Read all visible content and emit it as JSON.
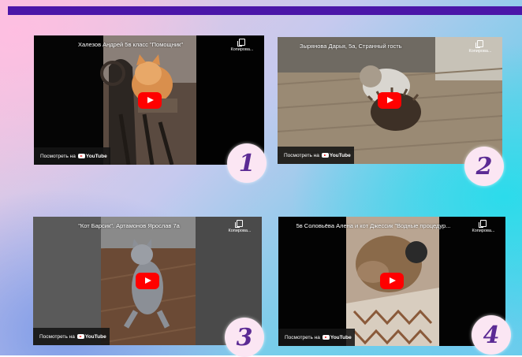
{
  "colors": {
    "top_bar": "#4b16a8",
    "badge_bg": "#fbe6f3",
    "badge_text": "#5b2a94",
    "play_red": "#ff0000"
  },
  "videos": [
    {
      "title": "Халезов Андрей 5в класс \"Помощник\"",
      "copy_label": "Копирова...",
      "watch_on": "Посмотреть на",
      "platform": "YouTube",
      "icons": [
        "copy-icon",
        "play-icon",
        "youtube-logo-icon"
      ],
      "number": "1"
    },
    {
      "title": "Зырянова Дарья, 5а, Странный гость",
      "copy_label": "Копирова...",
      "watch_on": "Посмотреть на",
      "platform": "YouTube",
      "icons": [
        "copy-icon",
        "play-icon",
        "youtube-logo-icon"
      ],
      "number": "2"
    },
    {
      "title": "\"Кот Барсик\". Артамонов Ярослав 7а",
      "copy_label": "Копирова...",
      "watch_on": "Посмотреть на",
      "platform": "YouTube",
      "icons": [
        "copy-icon",
        "play-icon",
        "youtube-logo-icon"
      ],
      "number": "3"
    },
    {
      "title": "5в Соловьёва Алена и кот Джессик \"Водные процедур...",
      "copy_label": "Копирова...",
      "watch_on": "Посмотреть на",
      "platform": "YouTube",
      "icons": [
        "copy-icon",
        "play-icon",
        "youtube-logo-icon"
      ],
      "number": "4"
    }
  ]
}
